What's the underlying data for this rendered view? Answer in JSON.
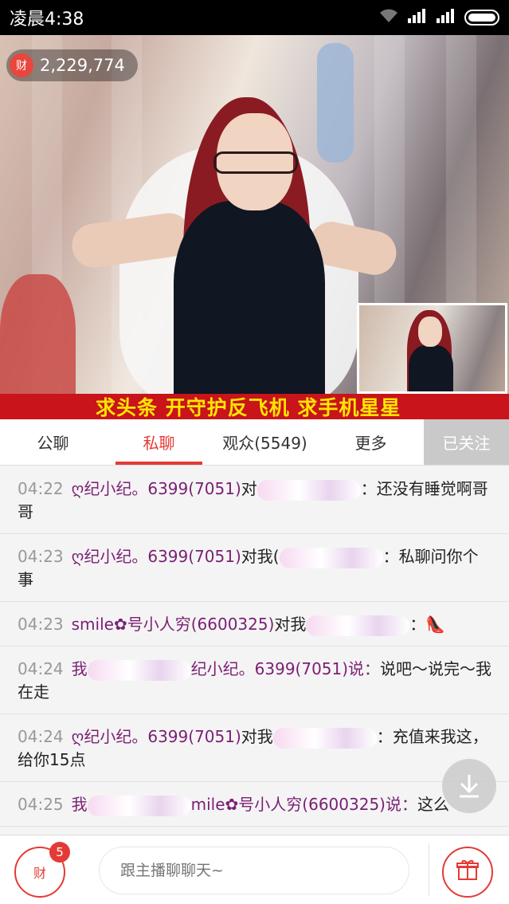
{
  "status_bar": {
    "time": "凌晨4:38",
    "wifi_icon": "wifi-icon",
    "signal_icon": "signal-icon",
    "battery_icon": "battery-icon"
  },
  "stream": {
    "coin_icon_label": "财",
    "coins": "2,229,774",
    "banner_text": "求头条  开守护反飞机  求手机星星"
  },
  "tabs": [
    {
      "label": "公聊"
    },
    {
      "label": "私聊"
    },
    {
      "label": "观众(5549)"
    },
    {
      "label": "更多"
    },
    {
      "label": "已关注"
    }
  ],
  "messages": [
    {
      "time": "04:22",
      "name": "ღ纪小纪。6399(7051)",
      "mid": "对",
      "text": "：",
      "tail": "还没有睡觉啊哥哥"
    },
    {
      "time": "04:23",
      "name": "ღ纪小纪。6399(7051)",
      "mid": "对我(",
      "text": "：",
      "tail": "私聊问你个事"
    },
    {
      "time": "04:23",
      "name": "smile✿号小人穷(6600325)",
      "mid": "对我",
      "text": "：",
      "tail": "👠"
    },
    {
      "time": "04:24",
      "name": "我",
      "mid": "",
      "text": "纪小纪。6399(7051)说：",
      "tail": "说吧～说完～我在走"
    },
    {
      "time": "04:24",
      "name": "ღ纪小纪。6399(7051)",
      "mid": "对我",
      "text": "：",
      "tail": "充值来我这，给你15点"
    },
    {
      "time": "04:25",
      "name": "我",
      "mid": "",
      "text": "mile✿号小人穷(6600325)说：",
      "tail": "这么"
    }
  ],
  "bottom_bar": {
    "coin_button_label": "财",
    "coin_badge": "5",
    "input_placeholder": "跟主播聊聊天~",
    "gift_icon": "gift-icon"
  },
  "scroll_down_icon": "download-arrow-icon"
}
